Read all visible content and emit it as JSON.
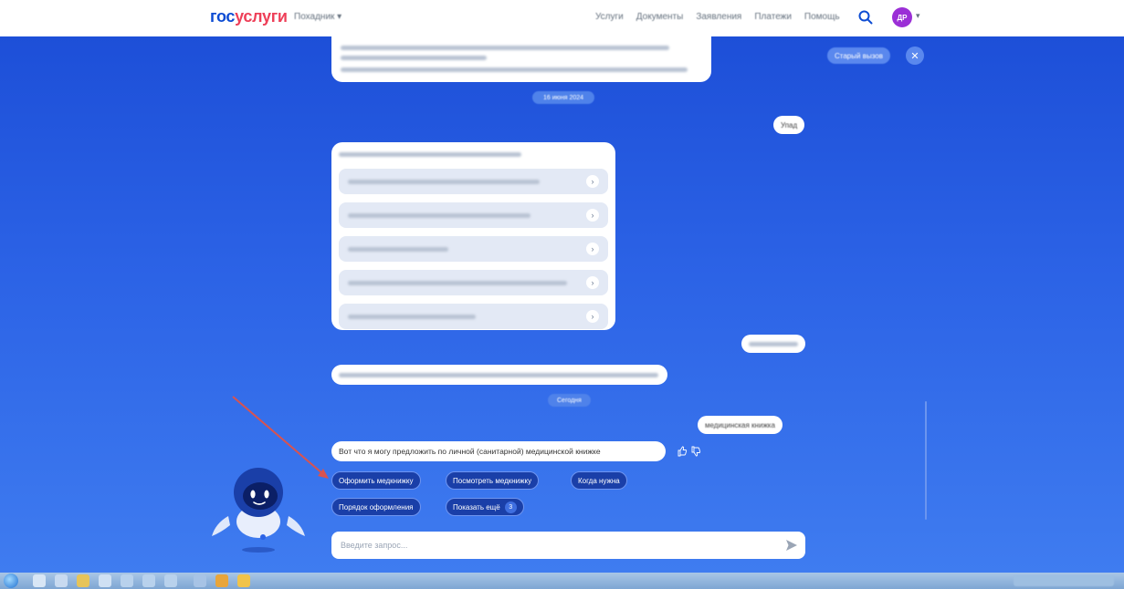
{
  "header": {
    "logo_gos": "гос",
    "logo_uslugi": "услуги",
    "region": "Похадник ▾",
    "nav": [
      "Услуги",
      "Документы",
      "Заявления",
      "Платежи",
      "Помощь"
    ],
    "avatar_initials": "ДР"
  },
  "chat": {
    "old_style_label": "Старый вызов",
    "date_label": "16 июня 2024",
    "user_msg_1": "Упад",
    "user_msg_3": "медицинская книжка",
    "today_label": "Сегодня",
    "bot_reply": "Вот что я могу предложить по личной (санитарной) медицинской книжке",
    "chips": [
      {
        "label": "Оформить медкнижку"
      },
      {
        "label": "Посмотреть медкнижку"
      },
      {
        "label": "Когда нужна"
      },
      {
        "label": "Порядок оформления"
      },
      {
        "label": "Показать ещё",
        "badge": "3"
      }
    ],
    "input_placeholder": "Введите запрос..."
  },
  "colors": {
    "brand_blue": "#0d4cd3",
    "brand_red": "#ee3f58",
    "chat_bg": "#2c63e6",
    "chip_bg": "#1a3fa8",
    "annotation_arrow": "#d9534f"
  },
  "icons": {
    "search": "search-icon",
    "close": "close-icon",
    "send": "send-icon",
    "like": "thumbs-up-icon",
    "dislike": "thumbs-down-icon"
  }
}
